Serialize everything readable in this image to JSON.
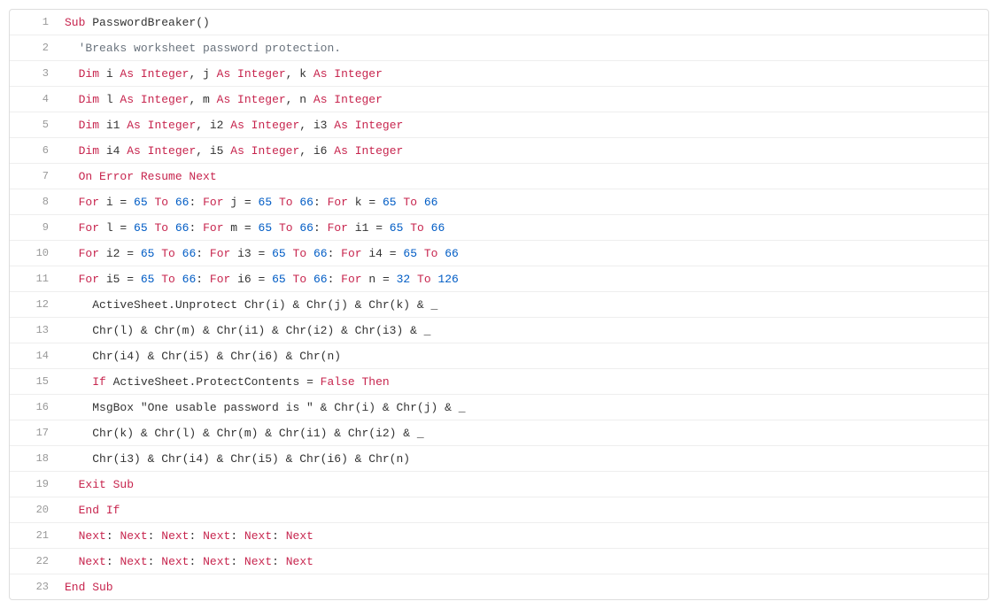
{
  "code": {
    "lines": [
      {
        "no": 1,
        "indent": 0,
        "tokens": [
          {
            "t": "Sub ",
            "c": "kw"
          },
          {
            "t": "PasswordBreaker()",
            "c": "id"
          }
        ]
      },
      {
        "no": 2,
        "indent": 1,
        "tokens": [
          {
            "t": "'Breaks worksheet password protection.",
            "c": "cmt"
          }
        ]
      },
      {
        "no": 3,
        "indent": 1,
        "tokens": [
          {
            "t": "Dim",
            "c": "kw"
          },
          {
            "t": " i ",
            "c": "id"
          },
          {
            "t": "As Integer",
            "c": "kw"
          },
          {
            "t": ", j ",
            "c": "id"
          },
          {
            "t": "As Integer",
            "c": "kw"
          },
          {
            "t": ", k ",
            "c": "id"
          },
          {
            "t": "As Integer",
            "c": "kw"
          }
        ]
      },
      {
        "no": 4,
        "indent": 1,
        "tokens": [
          {
            "t": "Dim",
            "c": "kw"
          },
          {
            "t": " l ",
            "c": "id"
          },
          {
            "t": "As Integer",
            "c": "kw"
          },
          {
            "t": ", m ",
            "c": "id"
          },
          {
            "t": "As Integer",
            "c": "kw"
          },
          {
            "t": ", n ",
            "c": "id"
          },
          {
            "t": "As Integer",
            "c": "kw"
          }
        ]
      },
      {
        "no": 5,
        "indent": 1,
        "tokens": [
          {
            "t": "Dim",
            "c": "kw"
          },
          {
            "t": " i1 ",
            "c": "id"
          },
          {
            "t": "As Integer",
            "c": "kw"
          },
          {
            "t": ", i2 ",
            "c": "id"
          },
          {
            "t": "As Integer",
            "c": "kw"
          },
          {
            "t": ", i3 ",
            "c": "id"
          },
          {
            "t": "As Integer",
            "c": "kw"
          }
        ]
      },
      {
        "no": 6,
        "indent": 1,
        "tokens": [
          {
            "t": "Dim",
            "c": "kw"
          },
          {
            "t": " i4 ",
            "c": "id"
          },
          {
            "t": "As Integer",
            "c": "kw"
          },
          {
            "t": ", i5 ",
            "c": "id"
          },
          {
            "t": "As Integer",
            "c": "kw"
          },
          {
            "t": ", i6 ",
            "c": "id"
          },
          {
            "t": "As Integer",
            "c": "kw"
          }
        ]
      },
      {
        "no": 7,
        "indent": 1,
        "tokens": [
          {
            "t": "On Error Resume Next",
            "c": "kw"
          }
        ]
      },
      {
        "no": 8,
        "indent": 1,
        "tokens": [
          {
            "t": "For",
            "c": "kw"
          },
          {
            "t": " i = ",
            "c": "id"
          },
          {
            "t": "65",
            "c": "num"
          },
          {
            "t": " ",
            "c": "id"
          },
          {
            "t": "To",
            "c": "kw"
          },
          {
            "t": " ",
            "c": "id"
          },
          {
            "t": "66",
            "c": "num"
          },
          {
            "t": ": ",
            "c": "id"
          },
          {
            "t": "For",
            "c": "kw"
          },
          {
            "t": " j = ",
            "c": "id"
          },
          {
            "t": "65",
            "c": "num"
          },
          {
            "t": " ",
            "c": "id"
          },
          {
            "t": "To",
            "c": "kw"
          },
          {
            "t": " ",
            "c": "id"
          },
          {
            "t": "66",
            "c": "num"
          },
          {
            "t": ": ",
            "c": "id"
          },
          {
            "t": "For",
            "c": "kw"
          },
          {
            "t": " k = ",
            "c": "id"
          },
          {
            "t": "65",
            "c": "num"
          },
          {
            "t": " ",
            "c": "id"
          },
          {
            "t": "To",
            "c": "kw"
          },
          {
            "t": " ",
            "c": "id"
          },
          {
            "t": "66",
            "c": "num"
          }
        ]
      },
      {
        "no": 9,
        "indent": 1,
        "tokens": [
          {
            "t": "For",
            "c": "kw"
          },
          {
            "t": " l = ",
            "c": "id"
          },
          {
            "t": "65",
            "c": "num"
          },
          {
            "t": " ",
            "c": "id"
          },
          {
            "t": "To",
            "c": "kw"
          },
          {
            "t": " ",
            "c": "id"
          },
          {
            "t": "66",
            "c": "num"
          },
          {
            "t": ": ",
            "c": "id"
          },
          {
            "t": "For",
            "c": "kw"
          },
          {
            "t": " m = ",
            "c": "id"
          },
          {
            "t": "65",
            "c": "num"
          },
          {
            "t": " ",
            "c": "id"
          },
          {
            "t": "To",
            "c": "kw"
          },
          {
            "t": " ",
            "c": "id"
          },
          {
            "t": "66",
            "c": "num"
          },
          {
            "t": ": ",
            "c": "id"
          },
          {
            "t": "For",
            "c": "kw"
          },
          {
            "t": " i1 = ",
            "c": "id"
          },
          {
            "t": "65",
            "c": "num"
          },
          {
            "t": " ",
            "c": "id"
          },
          {
            "t": "To",
            "c": "kw"
          },
          {
            "t": " ",
            "c": "id"
          },
          {
            "t": "66",
            "c": "num"
          }
        ]
      },
      {
        "no": 10,
        "indent": 1,
        "tokens": [
          {
            "t": "For",
            "c": "kw"
          },
          {
            "t": " i2 = ",
            "c": "id"
          },
          {
            "t": "65",
            "c": "num"
          },
          {
            "t": " ",
            "c": "id"
          },
          {
            "t": "To",
            "c": "kw"
          },
          {
            "t": " ",
            "c": "id"
          },
          {
            "t": "66",
            "c": "num"
          },
          {
            "t": ": ",
            "c": "id"
          },
          {
            "t": "For",
            "c": "kw"
          },
          {
            "t": " i3 = ",
            "c": "id"
          },
          {
            "t": "65",
            "c": "num"
          },
          {
            "t": " ",
            "c": "id"
          },
          {
            "t": "To",
            "c": "kw"
          },
          {
            "t": " ",
            "c": "id"
          },
          {
            "t": "66",
            "c": "num"
          },
          {
            "t": ": ",
            "c": "id"
          },
          {
            "t": "For",
            "c": "kw"
          },
          {
            "t": " i4 = ",
            "c": "id"
          },
          {
            "t": "65",
            "c": "num"
          },
          {
            "t": " ",
            "c": "id"
          },
          {
            "t": "To",
            "c": "kw"
          },
          {
            "t": " ",
            "c": "id"
          },
          {
            "t": "66",
            "c": "num"
          }
        ]
      },
      {
        "no": 11,
        "indent": 1,
        "tokens": [
          {
            "t": "For",
            "c": "kw"
          },
          {
            "t": " i5 = ",
            "c": "id"
          },
          {
            "t": "65",
            "c": "num"
          },
          {
            "t": " ",
            "c": "id"
          },
          {
            "t": "To",
            "c": "kw"
          },
          {
            "t": " ",
            "c": "id"
          },
          {
            "t": "66",
            "c": "num"
          },
          {
            "t": ": ",
            "c": "id"
          },
          {
            "t": "For",
            "c": "kw"
          },
          {
            "t": " i6 = ",
            "c": "id"
          },
          {
            "t": "65",
            "c": "num"
          },
          {
            "t": " ",
            "c": "id"
          },
          {
            "t": "To",
            "c": "kw"
          },
          {
            "t": " ",
            "c": "id"
          },
          {
            "t": "66",
            "c": "num"
          },
          {
            "t": ": ",
            "c": "id"
          },
          {
            "t": "For",
            "c": "kw"
          },
          {
            "t": " n = ",
            "c": "id"
          },
          {
            "t": "32",
            "c": "num"
          },
          {
            "t": " ",
            "c": "id"
          },
          {
            "t": "To",
            "c": "kw"
          },
          {
            "t": " ",
            "c": "id"
          },
          {
            "t": "126",
            "c": "num"
          }
        ]
      },
      {
        "no": 12,
        "indent": 2,
        "tokens": [
          {
            "t": "ActiveSheet.Unprotect Chr(i) & Chr(j) & Chr(k) & _",
            "c": "id"
          }
        ]
      },
      {
        "no": 13,
        "indent": 2,
        "tokens": [
          {
            "t": "Chr(l) & Chr(m) & Chr(i1) & Chr(i2) & Chr(i3) & _",
            "c": "id"
          }
        ]
      },
      {
        "no": 14,
        "indent": 2,
        "tokens": [
          {
            "t": "Chr(i4) & Chr(i5) & Chr(i6) & Chr(n)",
            "c": "id"
          }
        ]
      },
      {
        "no": 15,
        "indent": 2,
        "tokens": [
          {
            "t": "If",
            "c": "kw"
          },
          {
            "t": " ActiveSheet.ProtectContents = ",
            "c": "id"
          },
          {
            "t": "False Then",
            "c": "kw"
          }
        ]
      },
      {
        "no": 16,
        "indent": 2,
        "tokens": [
          {
            "t": "MsgBox ",
            "c": "id"
          },
          {
            "t": "\"One usable password is \"",
            "c": "str"
          },
          {
            "t": " & Chr(i) & Chr(j) & _",
            "c": "id"
          }
        ]
      },
      {
        "no": 17,
        "indent": 2,
        "tokens": [
          {
            "t": "Chr(k) & Chr(l) & Chr(m) & Chr(i1) & Chr(i2) & _",
            "c": "id"
          }
        ]
      },
      {
        "no": 18,
        "indent": 2,
        "tokens": [
          {
            "t": "Chr(i3) & Chr(i4) & Chr(i5) & Chr(i6) & Chr(n)",
            "c": "id"
          }
        ]
      },
      {
        "no": 19,
        "indent": 1,
        "tokens": [
          {
            "t": "Exit Sub",
            "c": "kw"
          }
        ]
      },
      {
        "no": 20,
        "indent": 1,
        "tokens": [
          {
            "t": "End If",
            "c": "kw"
          }
        ]
      },
      {
        "no": 21,
        "indent": 1,
        "tokens": [
          {
            "t": "Next",
            "c": "kw"
          },
          {
            "t": ": ",
            "c": "id"
          },
          {
            "t": "Next",
            "c": "kw"
          },
          {
            "t": ": ",
            "c": "id"
          },
          {
            "t": "Next",
            "c": "kw"
          },
          {
            "t": ": ",
            "c": "id"
          },
          {
            "t": "Next",
            "c": "kw"
          },
          {
            "t": ": ",
            "c": "id"
          },
          {
            "t": "Next",
            "c": "kw"
          },
          {
            "t": ": ",
            "c": "id"
          },
          {
            "t": "Next",
            "c": "kw"
          }
        ]
      },
      {
        "no": 22,
        "indent": 1,
        "tokens": [
          {
            "t": "Next",
            "c": "kw"
          },
          {
            "t": ": ",
            "c": "id"
          },
          {
            "t": "Next",
            "c": "kw"
          },
          {
            "t": ": ",
            "c": "id"
          },
          {
            "t": "Next",
            "c": "kw"
          },
          {
            "t": ": ",
            "c": "id"
          },
          {
            "t": "Next",
            "c": "kw"
          },
          {
            "t": ": ",
            "c": "id"
          },
          {
            "t": "Next",
            "c": "kw"
          },
          {
            "t": ": ",
            "c": "id"
          },
          {
            "t": "Next",
            "c": "kw"
          }
        ]
      },
      {
        "no": 23,
        "indent": 0,
        "tokens": [
          {
            "t": "End Sub",
            "c": "kw"
          }
        ]
      }
    ]
  },
  "indent_unit": "  "
}
